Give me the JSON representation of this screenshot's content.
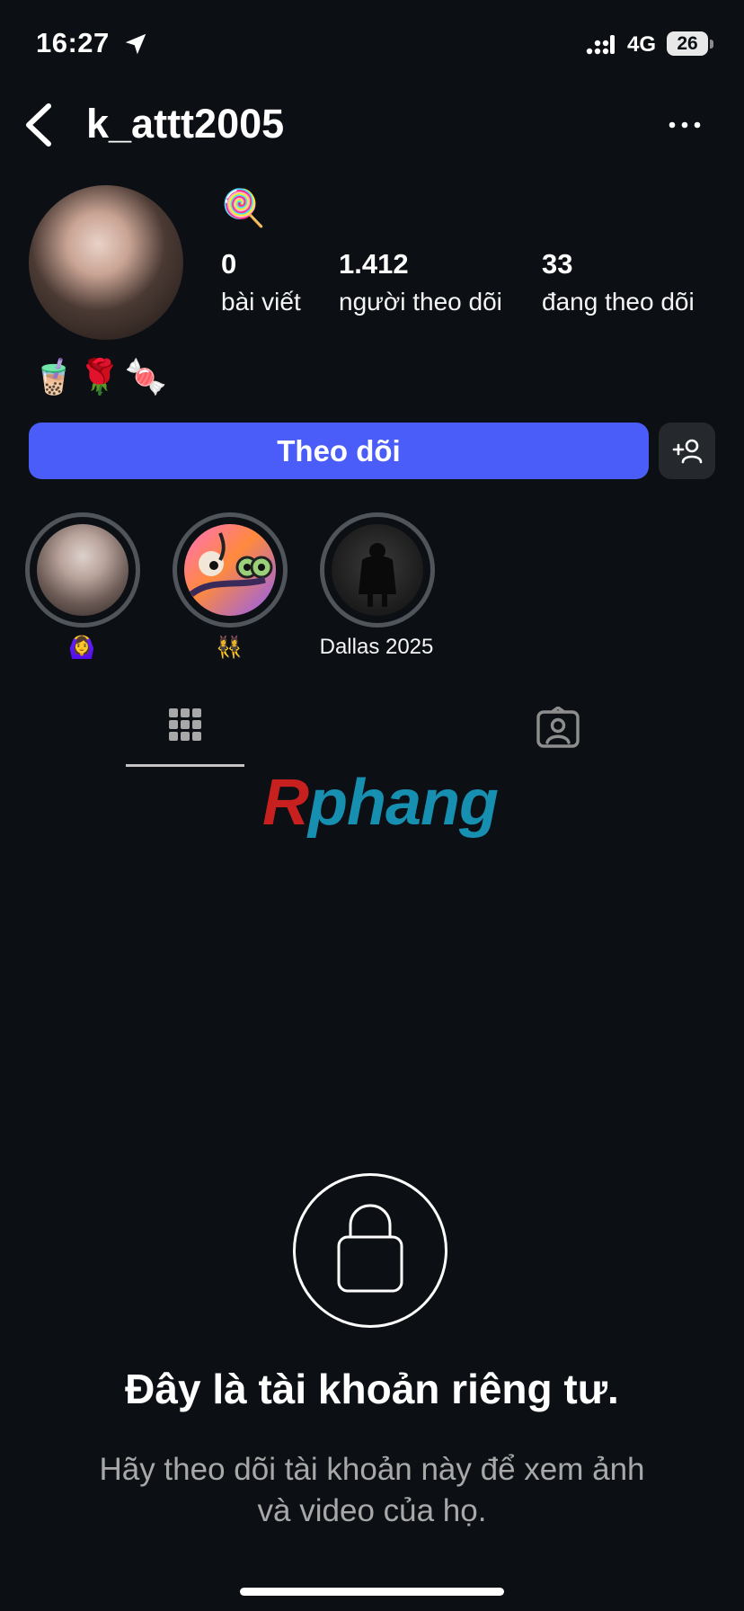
{
  "status_bar": {
    "time": "16:27",
    "network": "4G",
    "battery": "26",
    "icons": [
      "location-arrow-icon",
      "signal-icon"
    ]
  },
  "header": {
    "username": "k_attt2005",
    "icons": [
      "chevron-left-icon",
      "more-horizontal-icon"
    ]
  },
  "profile": {
    "name_emoji": "🍭",
    "stats": [
      {
        "value": "0",
        "label": "bài viết"
      },
      {
        "value": "1.412",
        "label": "người theo dõi"
      },
      {
        "value": "33",
        "label": "đang theo dõi"
      }
    ],
    "bio": "🧋🌹🍬"
  },
  "actions": {
    "follow_label": "Theo dõi",
    "suggest_icon": "add-person-icon"
  },
  "highlights": [
    {
      "label": "🙆‍♀️"
    },
    {
      "label": "👯‍♀️"
    },
    {
      "label": "Dallas 2025"
    }
  ],
  "tabs": [
    {
      "name": "grid",
      "icon": "grid-icon",
      "active": true
    },
    {
      "name": "tagged",
      "icon": "tagged-person-icon",
      "active": false
    }
  ],
  "watermark": {
    "first": "R",
    "rest": "phang",
    "colors": {
      "first": "#c8201e",
      "rest": "#178fb0"
    }
  },
  "private_notice": {
    "icon": "lock-icon",
    "title": "Đây là tài khoản riêng tư.",
    "subtitle_line1": "Hãy theo dõi tài khoản này để xem ảnh",
    "subtitle_line2": "và video của họ."
  },
  "colors": {
    "background": "#0c1014",
    "follow_button": "#4a5df9",
    "secondary_button": "#25292e",
    "muted_text": "#a8a8a8"
  }
}
